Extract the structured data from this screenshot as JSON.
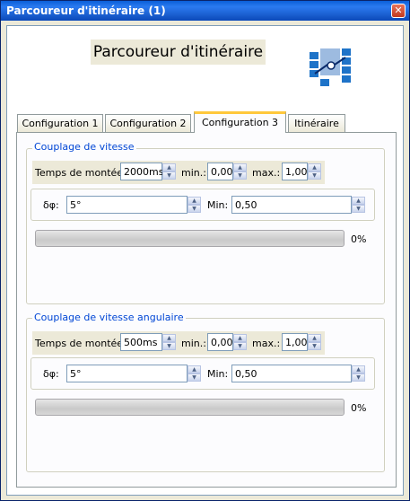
{
  "window": {
    "title": "Parcoureur d'itinéraire (1)",
    "close_label": "✕"
  },
  "header": {
    "title": "Parcoureur d'itinéraire"
  },
  "tabs": [
    {
      "label": "Configuration 1"
    },
    {
      "label": "Configuration 2"
    },
    {
      "label": "Configuration 3"
    },
    {
      "label": "Itinéraire"
    }
  ],
  "active_tab": "Configuration 3",
  "group1": {
    "title": "Couplage de vitesse",
    "rise_label": "Temps de montée:",
    "rise_value": "2000ms",
    "min_label": "min.:",
    "min_value": "0,00",
    "max_label": "max.:",
    "max_value": "1,00",
    "dphi_label": "δφ:",
    "dphi_value": "5°",
    "min2_label": "Min:",
    "min2_value": "0,50",
    "progress": 0,
    "progress_text": "0%"
  },
  "group2": {
    "title": "Couplage de vitesse angulaire",
    "rise_label": "Temps de montée:",
    "rise_value": "500ms",
    "min_label": "min.:",
    "min_value": "0,00",
    "max_label": "max.:",
    "max_value": "1,00",
    "dphi_label": "δφ:",
    "dphi_value": "5°",
    "min2_label": "Min:",
    "min2_value": "0,50",
    "progress": 0,
    "progress_text": "0%"
  },
  "icons": {
    "close": "close-icon",
    "logo": "route-logo-icon",
    "spin_up": "spin-up-icon",
    "spin_down": "spin-down-icon"
  }
}
